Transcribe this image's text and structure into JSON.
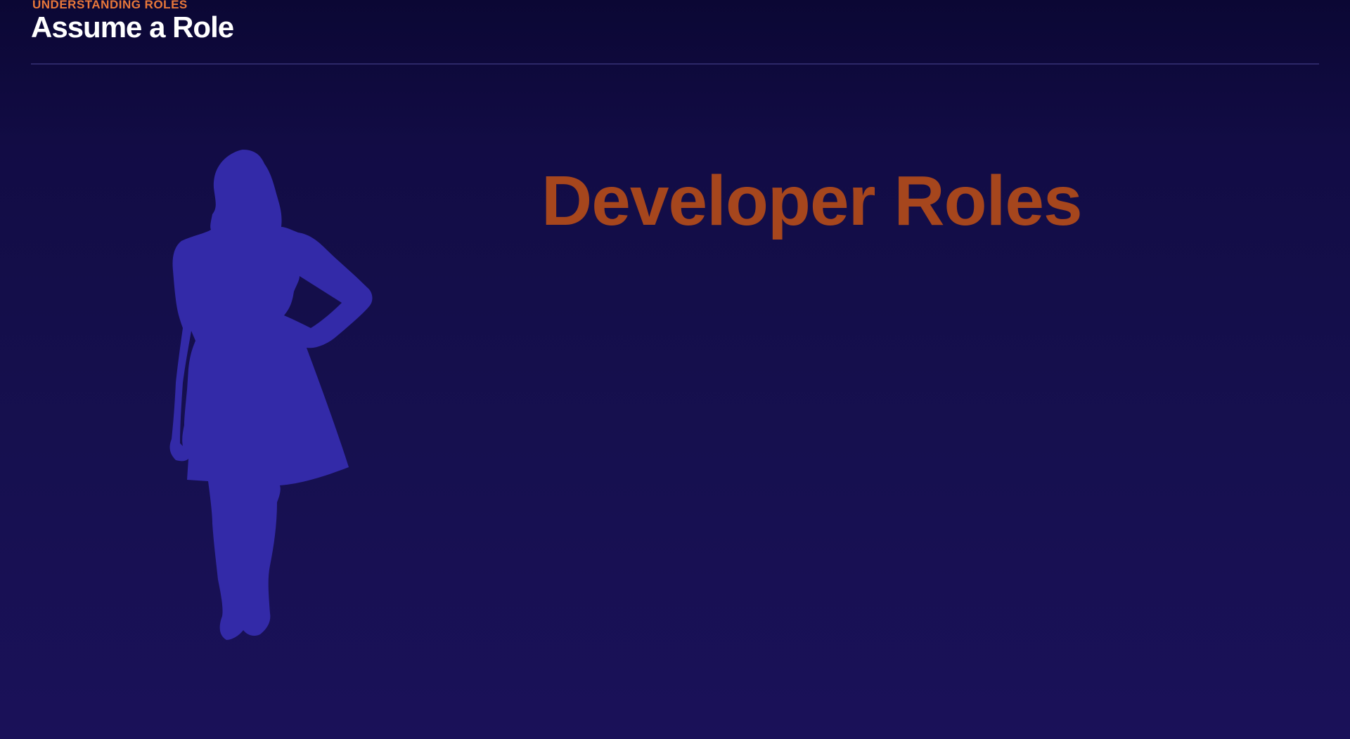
{
  "header": {
    "eyebrow": "UNDERSTANDING ROLES",
    "title": "Assume a Role"
  },
  "main": {
    "figure_icon": "woman-silhouette-icon",
    "role_heading": "Developer Roles"
  },
  "colors": {
    "background_top": "#0b0734",
    "background_bottom": "#1a1159",
    "eyebrow": "#e8773a",
    "title": "#ffffff",
    "heading": "#a6461d",
    "silhouette": "#332aa8",
    "divider": "#2d2768"
  }
}
